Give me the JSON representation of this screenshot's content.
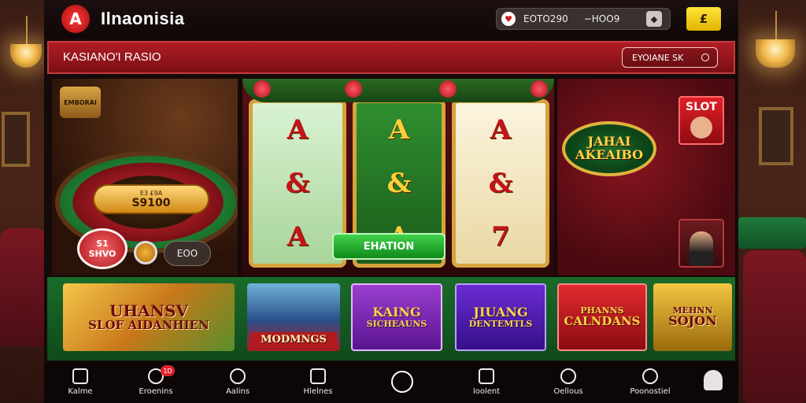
{
  "app": {
    "brand": "Ilnaonisia",
    "logo_letter": "A"
  },
  "header": {
    "balance_primary": "EOTO290",
    "balance_secondary": "−HOO9",
    "gold_button_label": "£"
  },
  "banner": {
    "title": "KASIANO'I RASIO",
    "action_label": "EYOIANE SK"
  },
  "hero_left": {
    "logo_text": "EMBORAI",
    "pill_small": "E3 £9A",
    "pill_big": "S9100",
    "chip_line1": "S1",
    "chip_line2": "SHVO",
    "dark_pill": "EOO"
  },
  "slot_machine": {
    "reels": [
      [
        "A",
        "&",
        "A"
      ],
      [
        "A",
        "&",
        "A"
      ],
      [
        "A",
        "&",
        "7"
      ]
    ],
    "spin_button": "EHATION"
  },
  "hero_right": {
    "jackpot_line1": "JAHAI",
    "jackpot_line2": "AKEAIBO",
    "slot_card_label": "SLOT"
  },
  "games": [
    {
      "line1": "UHANSV",
      "line2": "SLOF AIDANHIEN"
    },
    {
      "line1": "MODMNGS",
      "line2": ""
    },
    {
      "line1": "KAING",
      "line2": "SICHEAUNS"
    },
    {
      "line1": "JIUANG",
      "line2": "DENTEMTLS"
    },
    {
      "line1": "PHANNS",
      "line2": "CALNDANS"
    },
    {
      "line1": "MEHNN",
      "line2": "SOJON"
    }
  ],
  "bottom_nav": [
    {
      "label": "Kalme",
      "icon": "home-icon"
    },
    {
      "label": "Eroenins",
      "icon": "chat-icon",
      "badge": "1D"
    },
    {
      "label": "Aalins",
      "icon": "bell-icon"
    },
    {
      "label": "Hlelnes",
      "icon": "grid-icon"
    },
    {
      "label": "Ioolent",
      "icon": "bookmark-icon"
    },
    {
      "label": "Oellous",
      "icon": "shield-icon"
    },
    {
      "label": "Poonostiel",
      "icon": "user-icon"
    }
  ],
  "colors": {
    "accent_red": "#b01d24",
    "felt_green": "#1b6b2a",
    "gold": "#e0b33d"
  }
}
